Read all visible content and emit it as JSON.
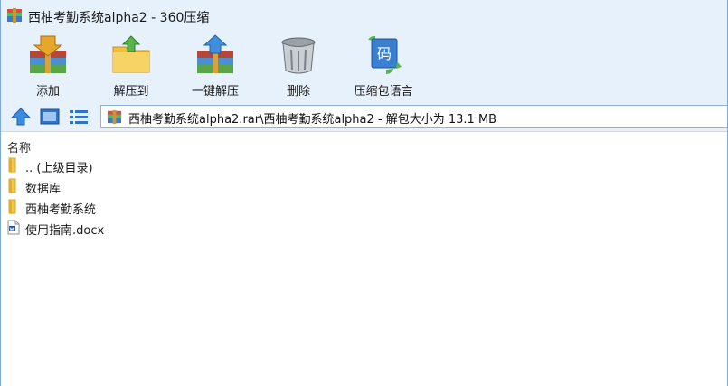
{
  "window": {
    "title": "西柚考勤系统alpha2 - 360压缩"
  },
  "toolbar": {
    "add_label": "添加",
    "extract_to_label": "解压到",
    "one_click_extract_label": "一键解压",
    "delete_label": "删除",
    "encoding_label": "压缩包语言",
    "encoding_icon_glyph": "码"
  },
  "address": {
    "path": "西柚考勤系统alpha2.rar\\西柚考勤系统alpha2 - 解包大小为 13.1 MB"
  },
  "list": {
    "column_name": "名称",
    "items": [
      {
        "label": ".. (上级目录)",
        "type": "folder"
      },
      {
        "label": "数据库",
        "type": "folder"
      },
      {
        "label": "西柚考勤系统",
        "type": "folder"
      },
      {
        "label": "使用指南.docx",
        "type": "docx"
      }
    ]
  },
  "colors": {
    "chrome_bg": "#e7f1fb",
    "border_blue": "#7fa9d6",
    "folder_yellow": "#f2c94c",
    "docx_blue": "#2b5797"
  }
}
